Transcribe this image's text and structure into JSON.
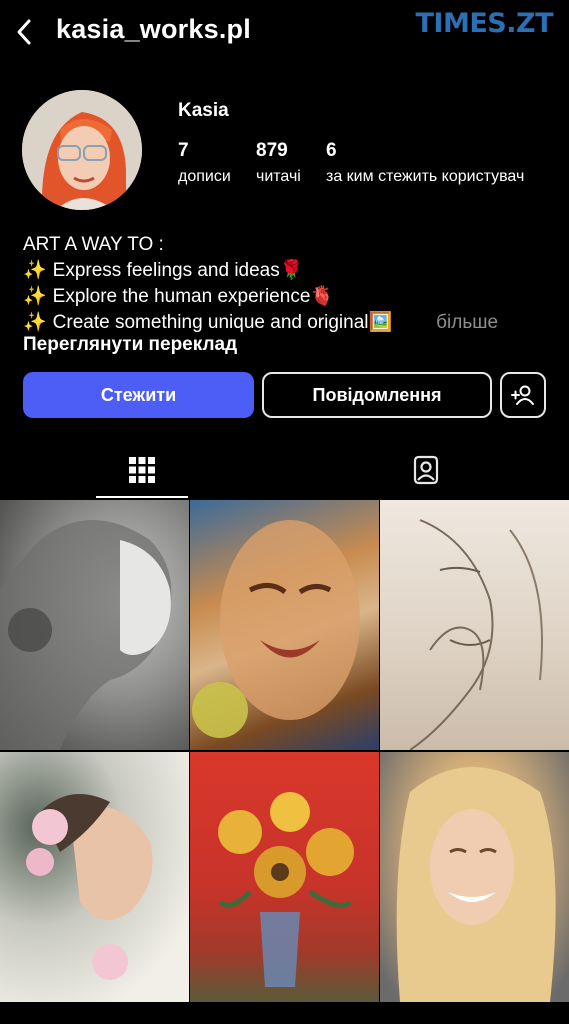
{
  "header": {
    "username": "kasia_works.pl",
    "watermark": "TIMES.ZT"
  },
  "profile": {
    "display_name": "Kasia",
    "stats": {
      "posts": {
        "count": "7",
        "label": "дописи"
      },
      "followers": {
        "count": "879",
        "label": "читачі"
      },
      "following": {
        "count": "6",
        "label": "за ким стежить користувач"
      }
    },
    "bio": {
      "line1": "ART A WAY TO :",
      "line2_spark": "✨",
      "line2": "Express feelings and ideas",
      "line2_emoji": "🌹",
      "line3_spark": "✨",
      "line3": "Explore the human experience",
      "line3_emoji": "🫀",
      "line4_spark": "✨",
      "line4": "Create something unique and original",
      "line4_emoji": "🖼️",
      "more": "більше"
    },
    "translate_label": "Переглянути переклад"
  },
  "actions": {
    "follow": "Стежити",
    "message": "Повідомлення"
  },
  "tabs": [
    {
      "name": "grid",
      "icon": "grid-icon",
      "active": true
    },
    {
      "name": "tagged",
      "icon": "tagged-person-icon",
      "active": false
    }
  ],
  "posts": [
    {
      "icon": "pencil-portrait-image"
    },
    {
      "icon": "painted-face-image"
    },
    {
      "icon": "sketch-woman-image"
    },
    {
      "icon": "watercolor-flowers-portrait-image"
    },
    {
      "icon": "sunflowers-painting-image"
    },
    {
      "icon": "smiling-blonde-portrait-image"
    }
  ],
  "colors": {
    "background": "#000000",
    "follow_button": "#4d5ef6",
    "muted_text": "#8e8e8e",
    "watermark": "#2c6fb4"
  }
}
